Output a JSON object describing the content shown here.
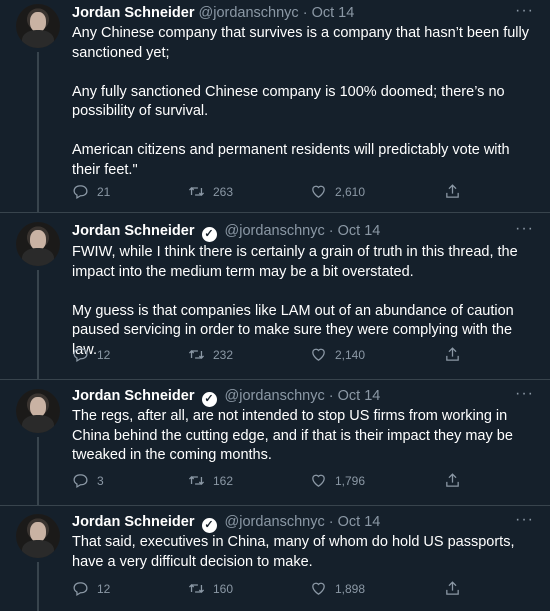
{
  "tweets": [
    {
      "name": "Jordan Schneider",
      "handle": "@jordanschnyc",
      "separator": "·",
      "date": "Oct 14",
      "paragraphs": [
        "Any Chinese company that survives is a company that hasn’t been fully sanctioned yet;",
        "Any fully sanctioned Chinese company is 100% doomed; there’s no possibility of survival.",
        "American citizens and permanent residents will predictably vote with their feet.\""
      ],
      "replies": "21",
      "retweets": "263",
      "likes": "2,610"
    },
    {
      "name": "Jordan Schneider",
      "handle": "@jordanschnyc",
      "separator": "·",
      "date": "Oct 14",
      "paragraphs": [
        "FWIW, while I think there is certainly a grain of truth in this thread, the impact into the medium term may be a bit overstated.",
        "My guess is that companies like LAM out of an abundance of caution paused servicing in order to make sure they were complying with the law."
      ],
      "replies": "12",
      "retweets": "232",
      "likes": "2,140"
    },
    {
      "name": "Jordan Schneider",
      "handle": "@jordanschnyc",
      "separator": "·",
      "date": "Oct 14",
      "paragraphs": [
        "The regs, after all, are not intended to stop US firms from working in China behind the cutting edge, and if that is their impact they may be tweaked in the coming months."
      ],
      "replies": "3",
      "retweets": "162",
      "likes": "1,796"
    },
    {
      "name": "Jordan Schneider",
      "handle": "@jordanschnyc",
      "separator": "·",
      "date": "Oct 14",
      "paragraphs": [
        "That said, executives in China, many of whom do hold US passports, have a very difficult decision to make."
      ],
      "replies": "12",
      "retweets": "160",
      "likes": "1,898"
    }
  ],
  "icons": {
    "verified": "verified-badge-icon",
    "more": "more-options-icon",
    "reply": "reply-icon",
    "retweet": "retweet-icon",
    "like": "like-icon",
    "share": "share-icon"
  },
  "colors": {
    "background": "#15202b",
    "text": "#ffffff",
    "muted": "#8b98a5",
    "divider": "#38444d"
  }
}
